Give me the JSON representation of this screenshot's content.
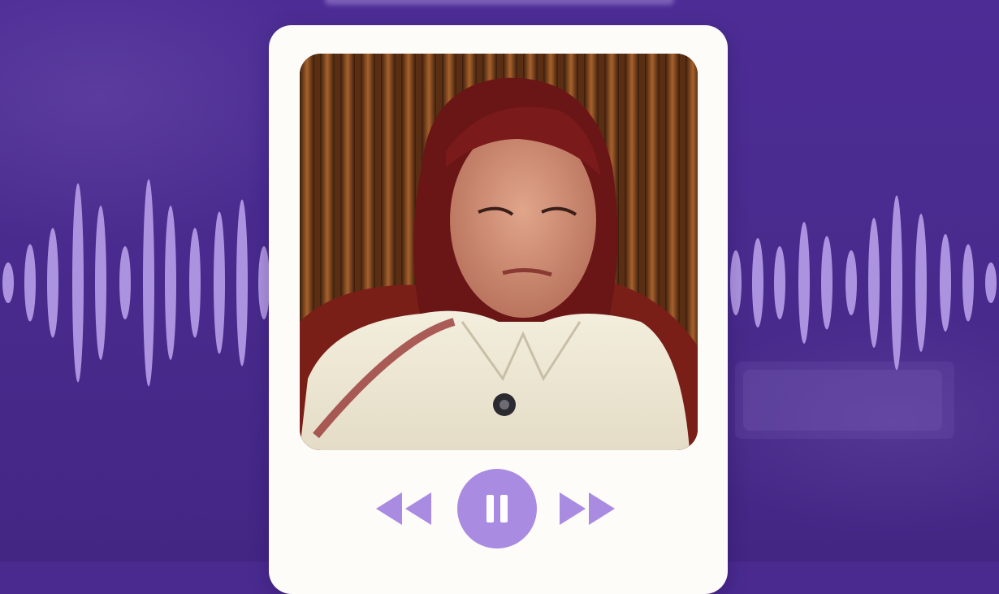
{
  "colors": {
    "background": "#4a2a8f",
    "card": "#fdfcf8",
    "accent": "#a98be2",
    "wave": "#b79ee8"
  },
  "player": {
    "state": "playing",
    "controls": [
      {
        "name": "rewind",
        "icon": "rewind-icon"
      },
      {
        "name": "pause",
        "icon": "pause-icon"
      },
      {
        "name": "fast-forward",
        "icon": "fast-forward-icon"
      }
    ]
  }
}
